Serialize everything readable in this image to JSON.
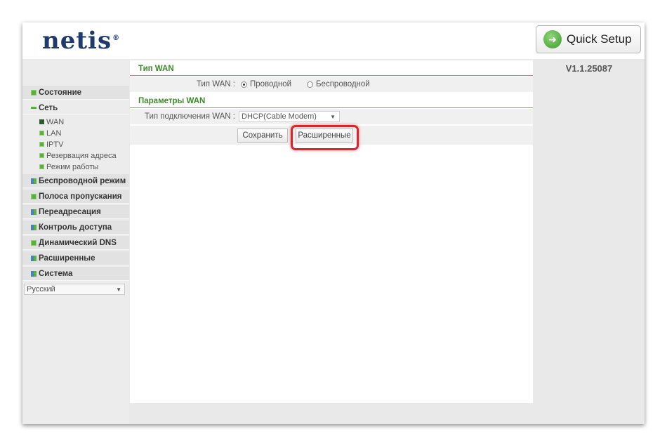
{
  "header": {
    "logo": "netis",
    "quick_setup_label": "Quick Setup",
    "version": "V1.1.25087"
  },
  "sidebar": {
    "items": [
      {
        "label": "Состояние"
      },
      {
        "label": "Сеть"
      },
      {
        "label": "Беспроводной режим"
      },
      {
        "label": "Полоса пропускания"
      },
      {
        "label": "Переадресация"
      },
      {
        "label": "Контроль доступа"
      },
      {
        "label": "Динамический DNS"
      },
      {
        "label": "Расширенные"
      },
      {
        "label": "Система"
      }
    ],
    "subitems": [
      {
        "label": "WAN"
      },
      {
        "label": "LAN"
      },
      {
        "label": "IPTV"
      },
      {
        "label": "Резервация адреса"
      },
      {
        "label": "Режим работы"
      }
    ],
    "language": "Русский"
  },
  "wan_type": {
    "title": "Тип WAN",
    "label": "Тип WAN :",
    "options": [
      {
        "label": "Проводной",
        "selected": true
      },
      {
        "label": "Беспроводной",
        "selected": false
      }
    ]
  },
  "wan_params": {
    "title": "Параметры WAN",
    "conn_label": "Тип подключения WAN :",
    "conn_value": "DHCP(Cable Modem)",
    "save_label": "Сохранить",
    "advanced_label": "Расширенные"
  },
  "colors": {
    "accent_green": "#5caf3e",
    "section_title": "#3f8a2c",
    "highlight_red": "#d8262b",
    "logo_blue": "#1f3a6b"
  }
}
